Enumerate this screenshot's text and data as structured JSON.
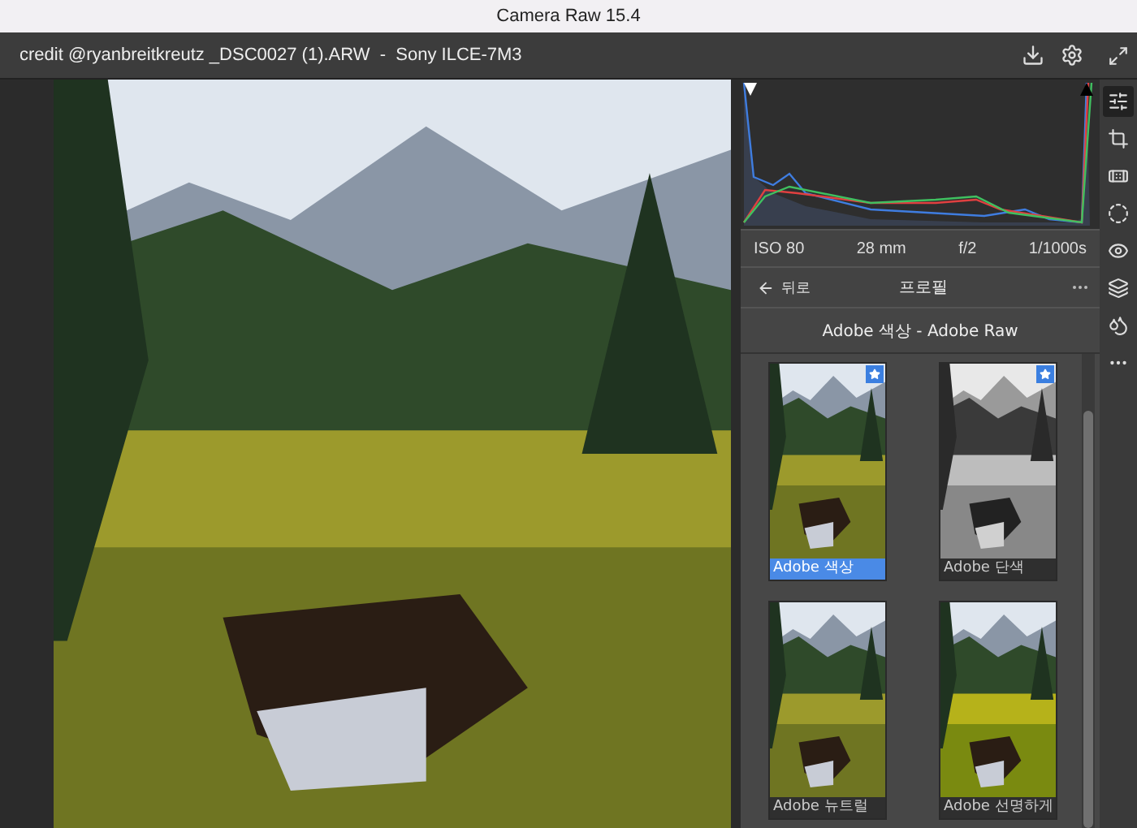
{
  "window": {
    "title": "Camera Raw 15.4"
  },
  "header": {
    "file_info": "credit @ryanbreitkreutz _DSC0027 (1).ARW  -  Sony ILCE-7M3"
  },
  "exif": [
    "ISO 80",
    "28 mm",
    "f/2",
    "1/1000s"
  ],
  "profile_nav": {
    "back_label": "뒤로",
    "title": "프로필"
  },
  "profile_group": "Adobe 색상 - Adobe Raw",
  "profiles": [
    {
      "name": "Adobe 색상",
      "kind": "color",
      "selected": true,
      "favorite": true
    },
    {
      "name": "Adobe 단색",
      "kind": "mono",
      "selected": false,
      "favorite": true
    },
    {
      "name": "Adobe 뉴트럴",
      "kind": "color",
      "selected": false,
      "favorite": false
    },
    {
      "name": "Adobe 선명하게",
      "kind": "vivid",
      "selected": false,
      "favorite": false
    }
  ],
  "tools": [
    {
      "kind": "edit",
      "selected": true
    },
    {
      "kind": "crop",
      "selected": false
    },
    {
      "kind": "heal",
      "selected": false
    },
    {
      "kind": "mask",
      "selected": false
    },
    {
      "kind": "redeye",
      "selected": false
    },
    {
      "kind": "presets",
      "selected": false
    },
    {
      "kind": "blend",
      "selected": false
    },
    {
      "kind": "more",
      "selected": false
    }
  ]
}
